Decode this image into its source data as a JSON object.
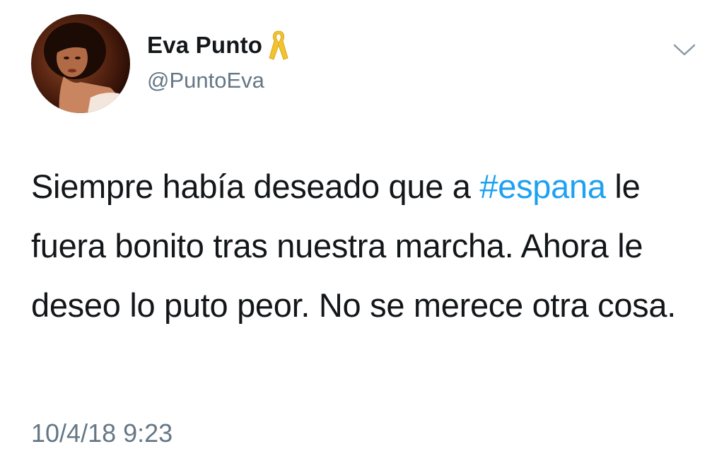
{
  "author": {
    "display_name": "Eva Punto",
    "handle": "@PuntoEva",
    "badge_icon": "yellow-ribbon-icon",
    "badge_color": "#f2c230"
  },
  "tweet": {
    "text_before": "Siempre había deseado que a ",
    "hashtag": "#espana",
    "text_after": " le fuera bonito tras nuestra marcha. Ahora le deseo lo puto peor. No se merece otra cosa.",
    "timestamp": "10/4/18 9:23"
  },
  "menu": {
    "icon": "chevron-down-icon"
  },
  "colors": {
    "text": "#14171a",
    "secondary": "#657786",
    "link": "#1da1f2"
  }
}
